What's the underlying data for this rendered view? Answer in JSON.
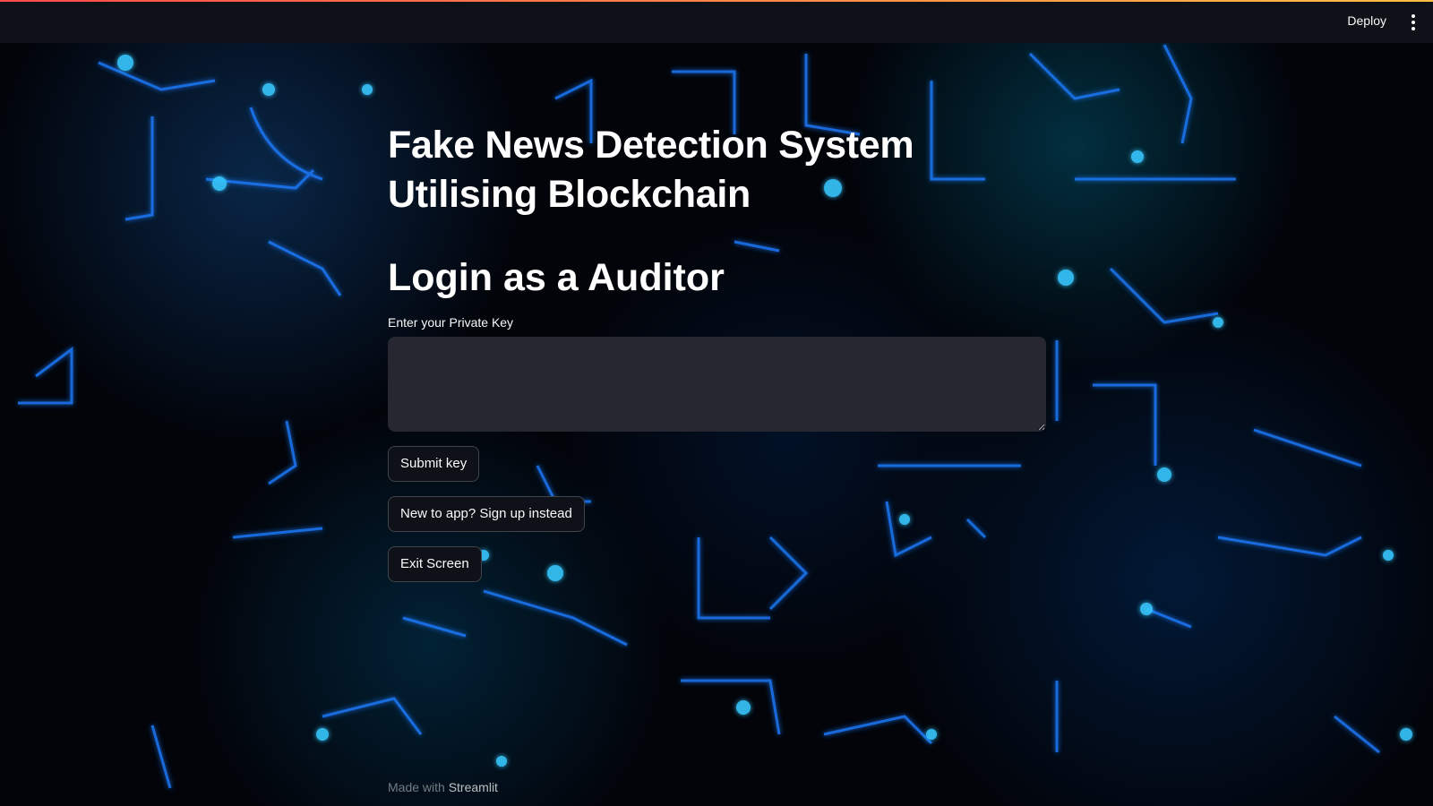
{
  "topbar": {
    "deploy_label": "Deploy",
    "menu_icon": "kebab-menu-icon",
    "accent_colors": [
      "#ff4b4b",
      "#ffbd45"
    ]
  },
  "main": {
    "title": "Fake News Detection System Utilising Blockchain",
    "subtitle": "Login as a Auditor",
    "private_key": {
      "label": "Enter your Private Key",
      "value": ""
    },
    "buttons": {
      "submit": "Submit key",
      "signup": "New to app? Sign up instead",
      "exit": "Exit Screen"
    }
  },
  "footer": {
    "prefix": "Made with",
    "brand": "Streamlit"
  },
  "colors": {
    "background": "#000000",
    "topbar": "#0e1117",
    "input_bg": "#262730",
    "glow": "#1e90ff"
  }
}
